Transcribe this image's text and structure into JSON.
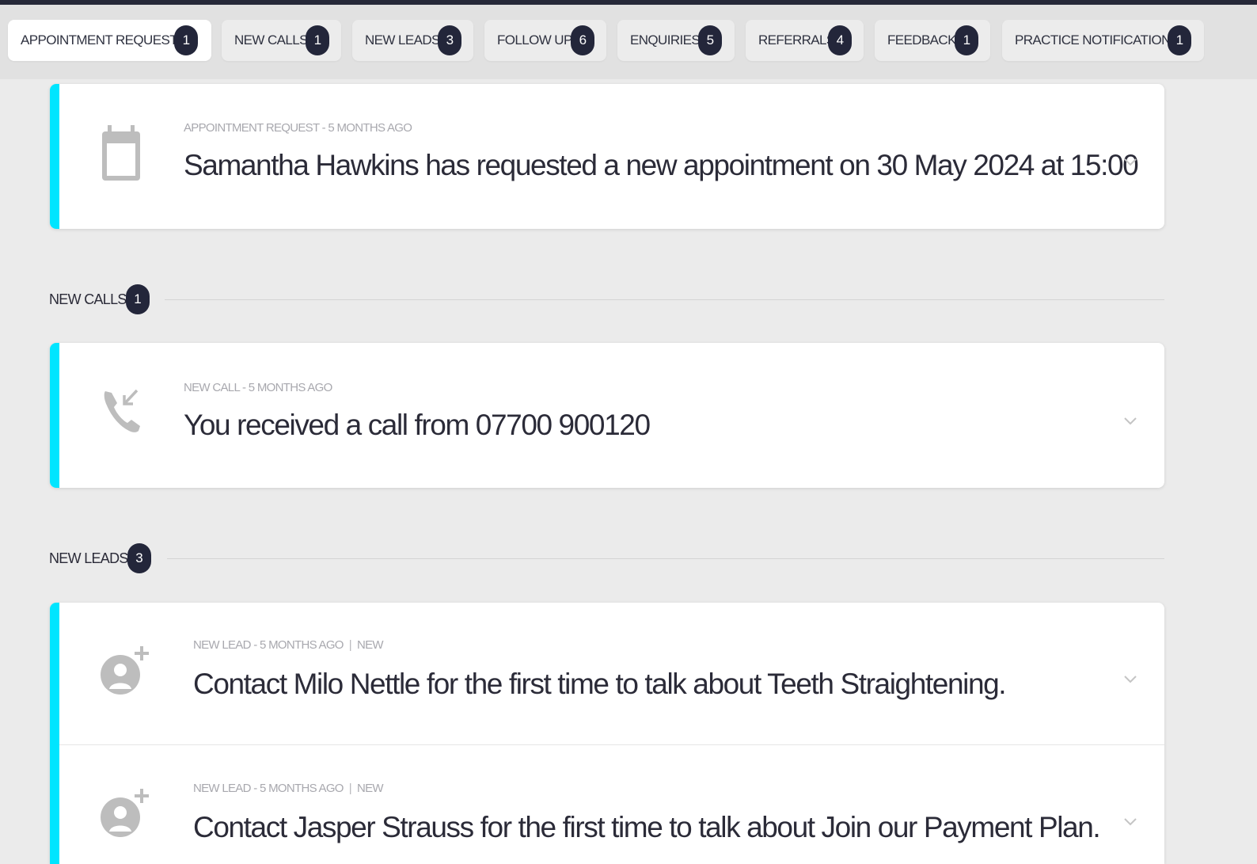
{
  "tabs": [
    {
      "label": "APPOINTMENT REQUESTS",
      "count": "1",
      "active": true
    },
    {
      "label": "NEW CALLS",
      "count": "1",
      "active": false
    },
    {
      "label": "NEW LEADS",
      "count": "3",
      "active": false
    },
    {
      "label": "FOLLOW UP",
      "count": "6",
      "active": false
    },
    {
      "label": "ENQUIRIES",
      "count": "5",
      "active": false
    },
    {
      "label": "REFERRALS",
      "count": "4",
      "active": false
    },
    {
      "label": "FEEDBACK",
      "count": "1",
      "active": false
    },
    {
      "label": "PRACTICE NOTIFICATIONS",
      "count": "1",
      "active": false
    }
  ],
  "appointment_requests": {
    "items": [
      {
        "icon": "calendar-icon",
        "meta": "APPOINTMENT REQUEST - 5 MONTHS AGO",
        "text": "Samantha Hawkins has requested a new appointment on 30 May 2024 at 15:00"
      }
    ]
  },
  "new_calls": {
    "title": "NEW CALLS",
    "count": "1",
    "items": [
      {
        "icon": "incoming-call-icon",
        "meta": "NEW CALL - 5 MONTHS AGO",
        "text": "You received a call from 07700 900120"
      }
    ]
  },
  "new_leads": {
    "title": "NEW LEADS",
    "count": "3",
    "items": [
      {
        "icon": "add-person-icon",
        "meta": "NEW LEAD - 5 MONTHS AGO",
        "status": "NEW",
        "text": "Contact Milo Nettle for the first time to talk about Teeth Straightening."
      },
      {
        "icon": "add-person-icon",
        "meta": "NEW LEAD - 5 MONTHS AGO",
        "status": "NEW",
        "text": "Contact Jasper Strauss for the first time to talk about Join our Payment Plan."
      }
    ]
  },
  "colors": {
    "accent": "#00e5ff",
    "badge": "#23263a",
    "top_strip": "#262838"
  }
}
